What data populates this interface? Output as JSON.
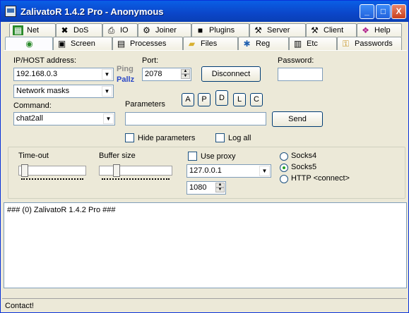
{
  "window": {
    "title": "ZalivatoR 1.4.2 Pro - Anonymous"
  },
  "titlebar_buttons": {
    "minimize": "_",
    "maximize": "□",
    "close": "X"
  },
  "tabs_row1": [
    {
      "label": "Net",
      "icon": "net-icon"
    },
    {
      "label": "DoS",
      "icon": "dos-icon"
    },
    {
      "label": "IO",
      "icon": "printer-icon"
    },
    {
      "label": "Joiner",
      "icon": "joiner-icon"
    },
    {
      "label": "Plugins",
      "icon": "floppy-icon"
    },
    {
      "label": "Server",
      "icon": "server-icon"
    },
    {
      "label": "Client",
      "icon": "client-icon"
    },
    {
      "label": "Help",
      "icon": "help-book-icon"
    }
  ],
  "tabs_row2": [
    {
      "label": "",
      "icon": "globe-icon"
    },
    {
      "label": "Screen",
      "icon": "screen-icon"
    },
    {
      "label": "Processes",
      "icon": "processes-icon"
    },
    {
      "label": "Files",
      "icon": "folder-icon"
    },
    {
      "label": "Reg",
      "icon": "registry-icon"
    },
    {
      "label": "Etc",
      "icon": "etc-icon"
    },
    {
      "label": "Passwords",
      "icon": "passwords-icon"
    }
  ],
  "form": {
    "host_label": "IP/HOST address:",
    "host_value": "192.168.0.3",
    "ping": "Ping",
    "pallz": "Pallz",
    "port_label": "Port:",
    "port_value": "2078",
    "disconnect": "Disconnect",
    "password_label": "Password:",
    "password_value": "",
    "network_masks": "Network masks",
    "command_label": "Command:",
    "command_value": "chat2all",
    "parameters_label": "Parameters",
    "parameters_value": "",
    "param_buttons": [
      "A",
      "P",
      "D",
      "L",
      "C"
    ],
    "send": "Send",
    "hide_parameters": "Hide parameters",
    "log_all": "Log all"
  },
  "settings": {
    "timeout_label": "Time-out",
    "buffer_label": "Buffer size",
    "use_proxy": "Use proxy",
    "proxy_host": "127.0.0.1",
    "proxy_port": "1080",
    "socks4": "Socks4",
    "socks5": "Socks5",
    "http": "HTTP <connect>",
    "selected_proxy": "Socks5"
  },
  "output": {
    "line1": "### (0) ZalivatoR 1.4.2 Pro ###"
  },
  "status": {
    "text": "Contact!"
  }
}
